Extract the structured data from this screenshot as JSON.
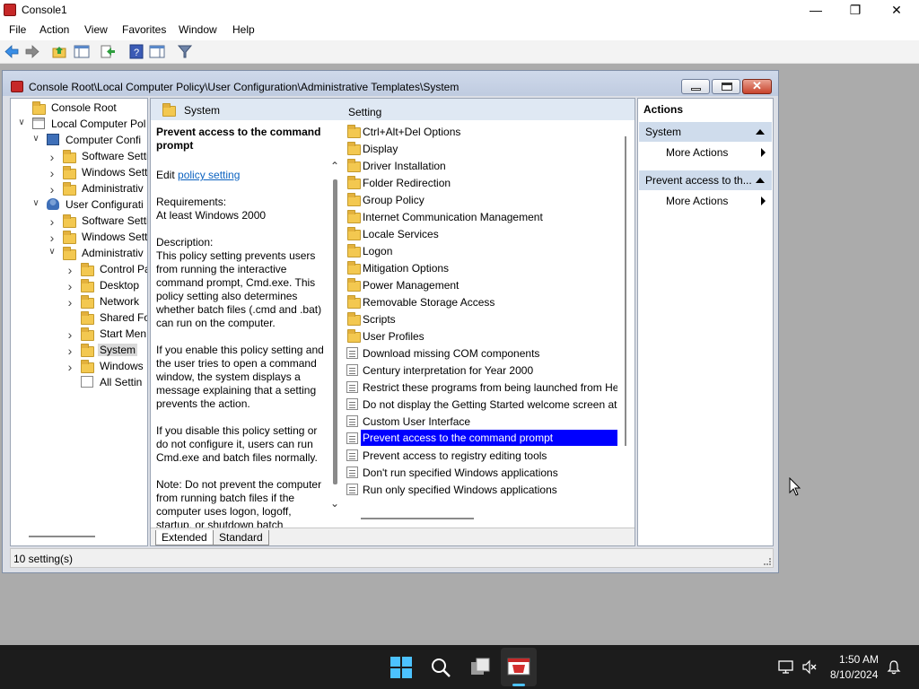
{
  "app": {
    "title": "Console1",
    "menu": [
      "File",
      "Action",
      "View",
      "Favorites",
      "Window",
      "Help"
    ]
  },
  "child": {
    "title": "Console Root\\Local Computer Policy\\User Configuration\\Administrative Templates\\System"
  },
  "tree": [
    {
      "label": "Console Root",
      "level": 0,
      "expander": "",
      "icon": "folder"
    },
    {
      "label": "Local Computer Pol",
      "level": 0,
      "expander": "open",
      "icon": "policy"
    },
    {
      "label": "Computer Confi",
      "level": 1,
      "expander": "open",
      "icon": "computer"
    },
    {
      "label": "Software Setti",
      "level": 2,
      "expander": "closed",
      "icon": "folder"
    },
    {
      "label": "Windows Setti",
      "level": 2,
      "expander": "closed",
      "icon": "folder"
    },
    {
      "label": "Administrativ",
      "level": 2,
      "expander": "closed",
      "icon": "folder"
    },
    {
      "label": "User Configurati",
      "level": 1,
      "expander": "open",
      "icon": "user"
    },
    {
      "label": "Software Setti",
      "level": 2,
      "expander": "closed",
      "icon": "folder"
    },
    {
      "label": "Windows Setti",
      "level": 2,
      "expander": "closed",
      "icon": "folder"
    },
    {
      "label": "Administrativ",
      "level": 2,
      "expander": "open",
      "icon": "folder"
    },
    {
      "label": "Control Pa",
      "level": 3,
      "expander": "closed",
      "icon": "folder"
    },
    {
      "label": "Desktop",
      "level": 3,
      "expander": "closed",
      "icon": "folder"
    },
    {
      "label": "Network",
      "level": 3,
      "expander": "closed",
      "icon": "folder"
    },
    {
      "label": "Shared Fo",
      "level": 3,
      "expander": "",
      "icon": "folder"
    },
    {
      "label": "Start Men",
      "level": 3,
      "expander": "closed",
      "icon": "folder"
    },
    {
      "label": "System",
      "level": 3,
      "expander": "closed",
      "icon": "folder",
      "selected": true
    },
    {
      "label": "Windows",
      "level": 3,
      "expander": "closed",
      "icon": "folder"
    },
    {
      "label": "All Settin",
      "level": 3,
      "expander": "",
      "icon": "settings"
    }
  ],
  "center": {
    "heading": "System",
    "column_header": "Setting",
    "desc_title": "Prevent access to the command prompt",
    "edit_prefix": "Edit",
    "edit_link": "policy setting",
    "requirements_label": "Requirements:",
    "requirements_value": "At least Windows 2000",
    "description_label": "Description:",
    "p1": "This policy setting prevents users from running the interactive command prompt, Cmd.exe.  This policy setting also determines whether batch files (.cmd and .bat) can run on the computer.",
    "p2": "If you enable this policy setting and the user tries to open a command window, the system displays a message explaining that a setting prevents the action.",
    "p3": "If you disable this policy setting or do not configure it, users can run Cmd.exe and batch files normally.",
    "p4": "Note: Do not prevent the computer from running batch files if the computer uses logon, logoff, startup, or shutdown batch",
    "tabs": [
      "Extended",
      "Standard"
    ]
  },
  "settings": [
    {
      "label": "Ctrl+Alt+Del Options",
      "kind": "folder"
    },
    {
      "label": "Display",
      "kind": "folder"
    },
    {
      "label": "Driver Installation",
      "kind": "folder"
    },
    {
      "label": "Folder Redirection",
      "kind": "folder"
    },
    {
      "label": "Group Policy",
      "kind": "folder"
    },
    {
      "label": "Internet Communication Management",
      "kind": "folder"
    },
    {
      "label": "Locale Services",
      "kind": "folder"
    },
    {
      "label": "Logon",
      "kind": "folder"
    },
    {
      "label": "Mitigation Options",
      "kind": "folder"
    },
    {
      "label": "Power Management",
      "kind": "folder"
    },
    {
      "label": "Removable Storage Access",
      "kind": "folder"
    },
    {
      "label": "Scripts",
      "kind": "folder"
    },
    {
      "label": "User Profiles",
      "kind": "folder"
    },
    {
      "label": "Download missing COM components",
      "kind": "policy"
    },
    {
      "label": "Century interpretation for Year 2000",
      "kind": "policy"
    },
    {
      "label": "Restrict these programs from being launched from He",
      "kind": "policy"
    },
    {
      "label": "Do not display the Getting Started welcome screen at l",
      "kind": "policy"
    },
    {
      "label": "Custom User Interface",
      "kind": "policy"
    },
    {
      "label": "Prevent access to the command prompt",
      "kind": "policy",
      "selected": true
    },
    {
      "label": "Prevent access to registry editing tools",
      "kind": "policy"
    },
    {
      "label": "Don't run specified Windows applications",
      "kind": "policy"
    },
    {
      "label": "Run only specified Windows applications",
      "kind": "policy"
    }
  ],
  "actions": {
    "header": "Actions",
    "sections": [
      {
        "title": "System",
        "items": [
          "More Actions"
        ]
      },
      {
        "title": "Prevent access to th...",
        "items": [
          "More Actions"
        ]
      }
    ]
  },
  "status": {
    "text": "10 setting(s)"
  },
  "taskbar": {
    "time": "1:50 AM",
    "date": "8/10/2024"
  }
}
